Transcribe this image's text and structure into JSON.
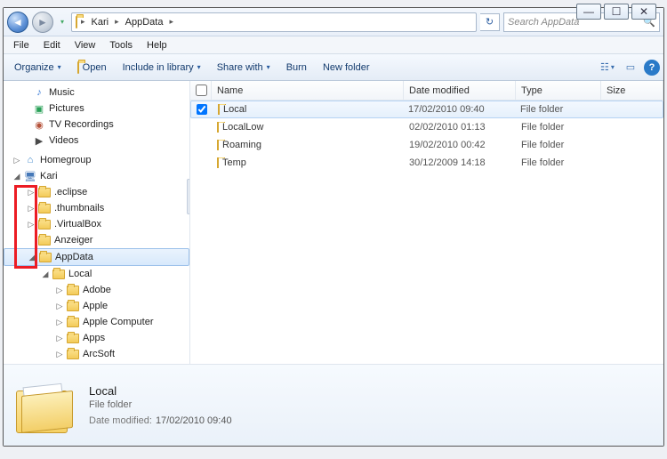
{
  "caption": {
    "min": "—",
    "max": "☐",
    "close": "✕"
  },
  "nav": {
    "back_glyph": "◄",
    "fwd_glyph": "►",
    "crumbs": [
      "Kari",
      "AppData"
    ],
    "sep_glyph": "▸",
    "refresh_glyph": "↻"
  },
  "search": {
    "placeholder": "Search AppData",
    "glyph": "🔍"
  },
  "menu": {
    "file": "File",
    "edit": "Edit",
    "view": "View",
    "tools": "Tools",
    "help": "Help"
  },
  "toolbar": {
    "organize": "Organize",
    "open": "Open",
    "include": "Include in library",
    "share": "Share with",
    "burn": "Burn",
    "newfolder": "New folder",
    "dd_glyph": "▾",
    "view_glyph": "☷",
    "preview_glyph": "▭",
    "help_glyph": "?"
  },
  "sidebar": {
    "music": "Music",
    "pictures": "Pictures",
    "tv": "TV Recordings",
    "videos": "Videos",
    "homegroup": "Homegroup",
    "kari": "Kari",
    "eclipse": ".eclipse",
    "thumbnails": ".thumbnails",
    "virtualbox": ".VirtualBox",
    "anzeiger": "Anzeiger",
    "appdata": "AppData",
    "local": "Local",
    "adobe": "Adobe",
    "apple": "Apple",
    "applecomp": "Apple Computer",
    "apps": "Apps",
    "arcsoft": "ArcSoft",
    "tw_collapsed": "▷",
    "tw_expanded": "◢"
  },
  "columns": {
    "name": "Name",
    "date": "Date modified",
    "type": "Type",
    "size": "Size"
  },
  "rows": [
    {
      "name": "Local",
      "date": "17/02/2010 09:40",
      "type": "File folder",
      "selected": true,
      "checked": true
    },
    {
      "name": "LocalLow",
      "date": "02/02/2010 01:13",
      "type": "File folder",
      "selected": false,
      "checked": false
    },
    {
      "name": "Roaming",
      "date": "19/02/2010 00:42",
      "type": "File folder",
      "selected": false,
      "checked": false
    },
    {
      "name": "Temp",
      "date": "30/12/2009 14:18",
      "type": "File folder",
      "selected": false,
      "checked": false
    }
  ],
  "details": {
    "title": "Local",
    "subtitle": "File folder",
    "date_label": "Date modified:",
    "date_value": "17/02/2010 09:40"
  }
}
